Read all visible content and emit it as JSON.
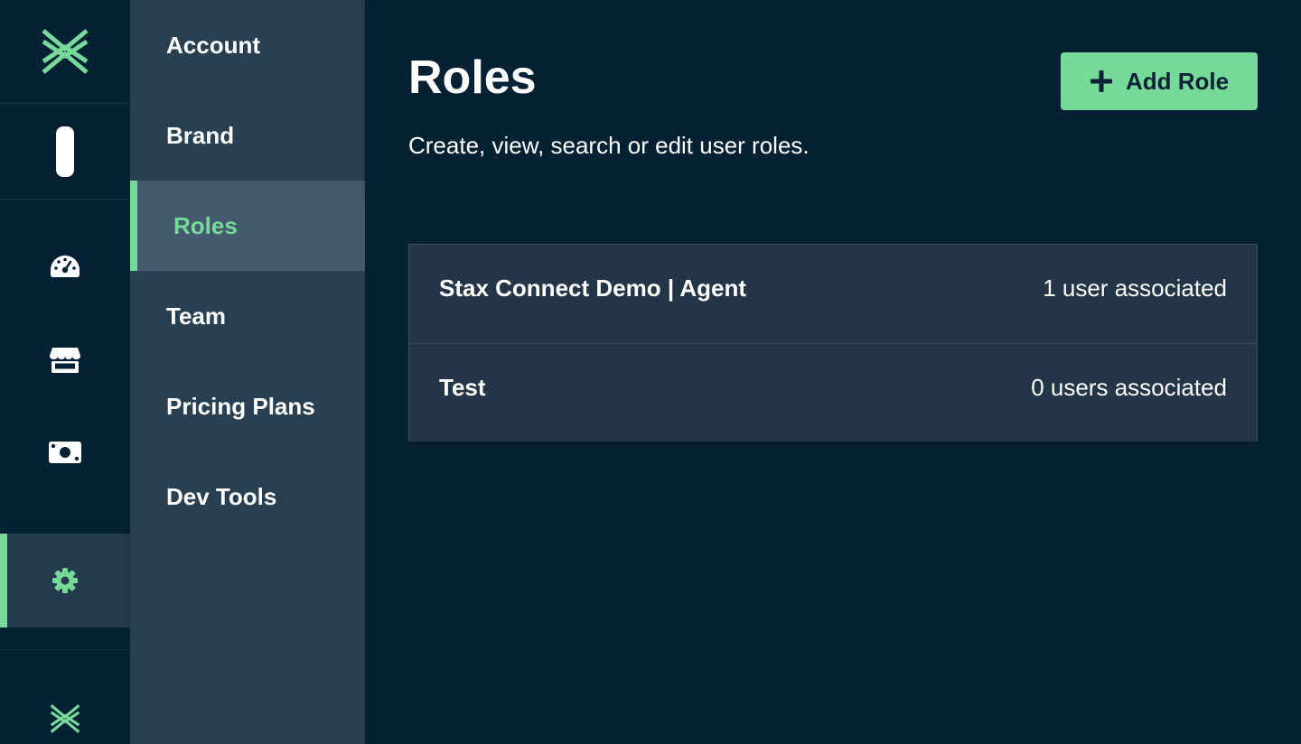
{
  "rail": {
    "logo_icon": "stax-logo-icon",
    "toggle_icon": "toggle-pill-icon",
    "items": [
      {
        "icon": "speedometer-icon"
      },
      {
        "icon": "storefront-icon"
      },
      {
        "icon": "money-icon"
      },
      {
        "icon": "gear-icon",
        "active": true
      }
    ],
    "bottom_logo_icon": "stax-logo-icon"
  },
  "submenu": {
    "items": [
      {
        "label": "Account"
      },
      {
        "label": "Brand"
      },
      {
        "label": "Roles",
        "active": true
      },
      {
        "label": "Team"
      },
      {
        "label": "Pricing Plans"
      },
      {
        "label": "Dev Tools"
      }
    ]
  },
  "header": {
    "title": "Roles",
    "subtitle": "Create, view, search or edit user roles.",
    "add_button_label": "Add Role",
    "add_button_icon": "plus-icon"
  },
  "roles": [
    {
      "name": "Stax Connect Demo | Agent",
      "users": "1 user associated"
    },
    {
      "name": "Test",
      "users": "0 users associated"
    }
  ],
  "colors": {
    "accent": "#76d99a",
    "background": "#062133",
    "submenu": "#284052",
    "submenu_active": "#445b6f",
    "row": "#233546"
  }
}
